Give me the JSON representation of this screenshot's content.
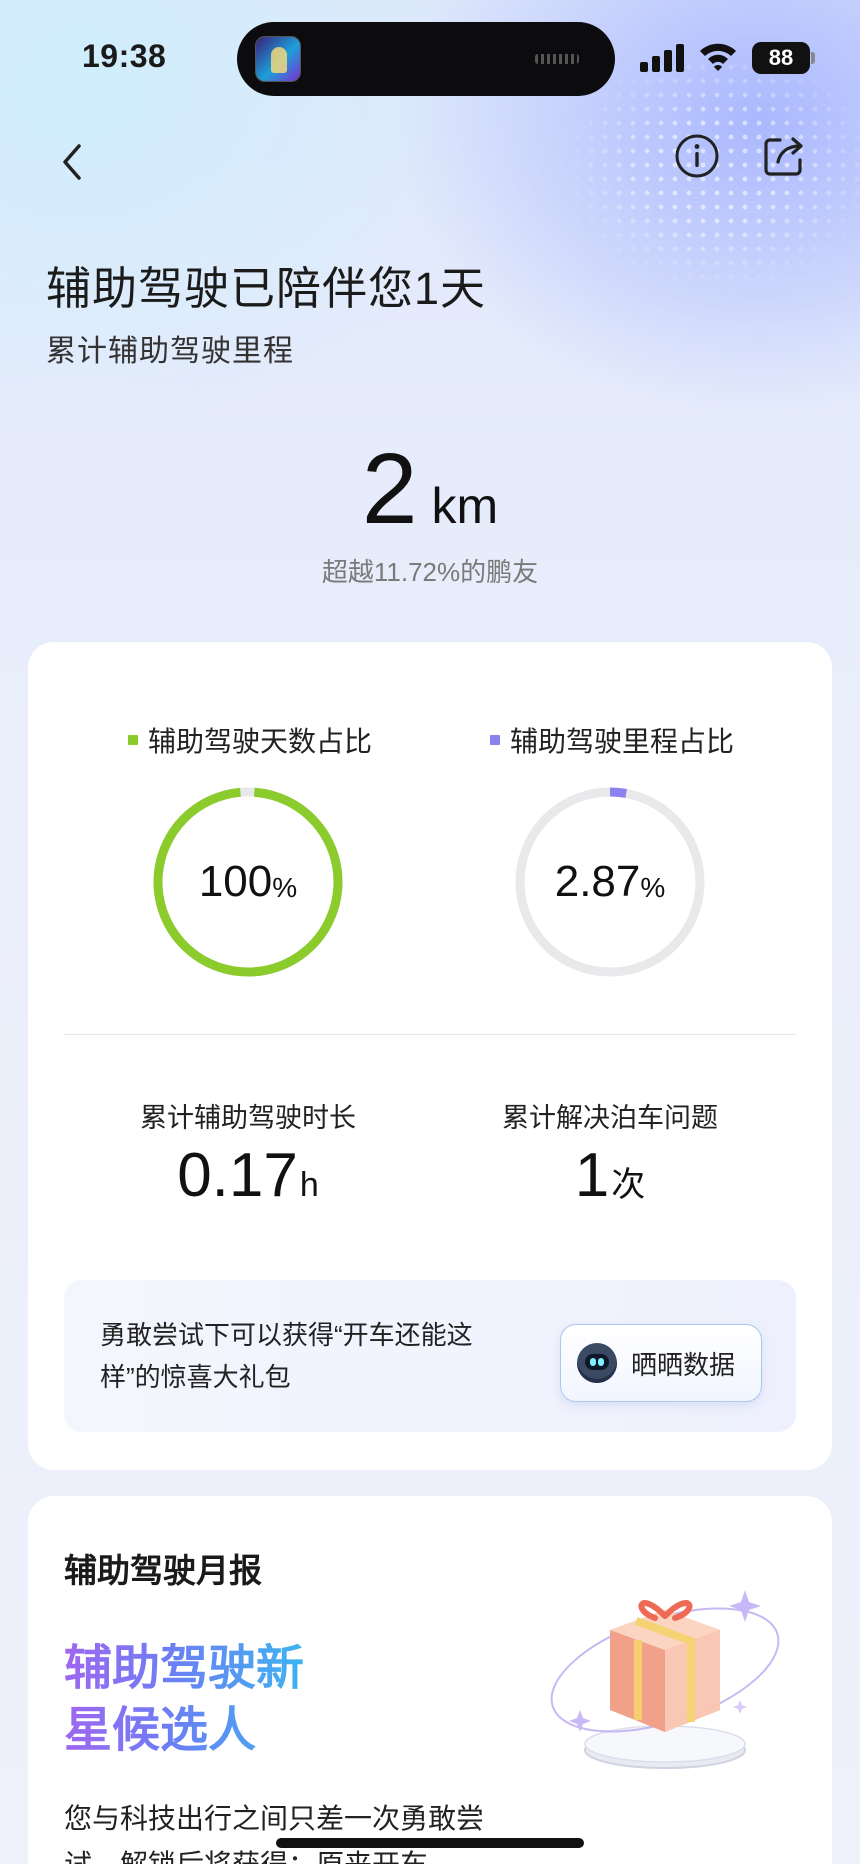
{
  "status_bar": {
    "time": "19:38",
    "battery": "88",
    "icons": [
      "signal-icon",
      "wifi-icon",
      "battery-icon"
    ]
  },
  "nav": {
    "back_icon": "chevron-left-icon",
    "info_icon": "info-icon",
    "share_icon": "share-icon"
  },
  "header": {
    "title": "辅助驾驶已陪伴您1天",
    "subtitle": "累计辅助驾驶里程",
    "mileage_value": "2",
    "mileage_unit": "km",
    "surpass_text": "超越11.72%的鹏友"
  },
  "ratios": [
    {
      "label": "辅助驾驶天数占比",
      "value": "100",
      "unit": "%",
      "fraction": 1.0,
      "color": "#8ccb2c"
    },
    {
      "label": "辅助驾驶里程占比",
      "value": "2.87",
      "unit": "%",
      "fraction": 0.0287,
      "color": "#8b82f0"
    }
  ],
  "ring_track_color": "#e9e9ec",
  "stats": [
    {
      "label": "累计辅助驾驶时长",
      "value": "0.17",
      "unit": "h"
    },
    {
      "label": "累计解决泊车问题",
      "value": "1",
      "unit": "次"
    }
  ],
  "promo": {
    "text": "勇敢尝试下可以获得“开车还能这样”的惊喜大礼包",
    "button_label": "晒晒数据"
  },
  "monthly": {
    "title": "辅助驾驶月报",
    "headline_line1": "辅助驾驶新",
    "headline_line2": "星候选人",
    "description": "您与科技出行之间只差一次勇敢尝试，解锁后将获得：原来开车"
  }
}
